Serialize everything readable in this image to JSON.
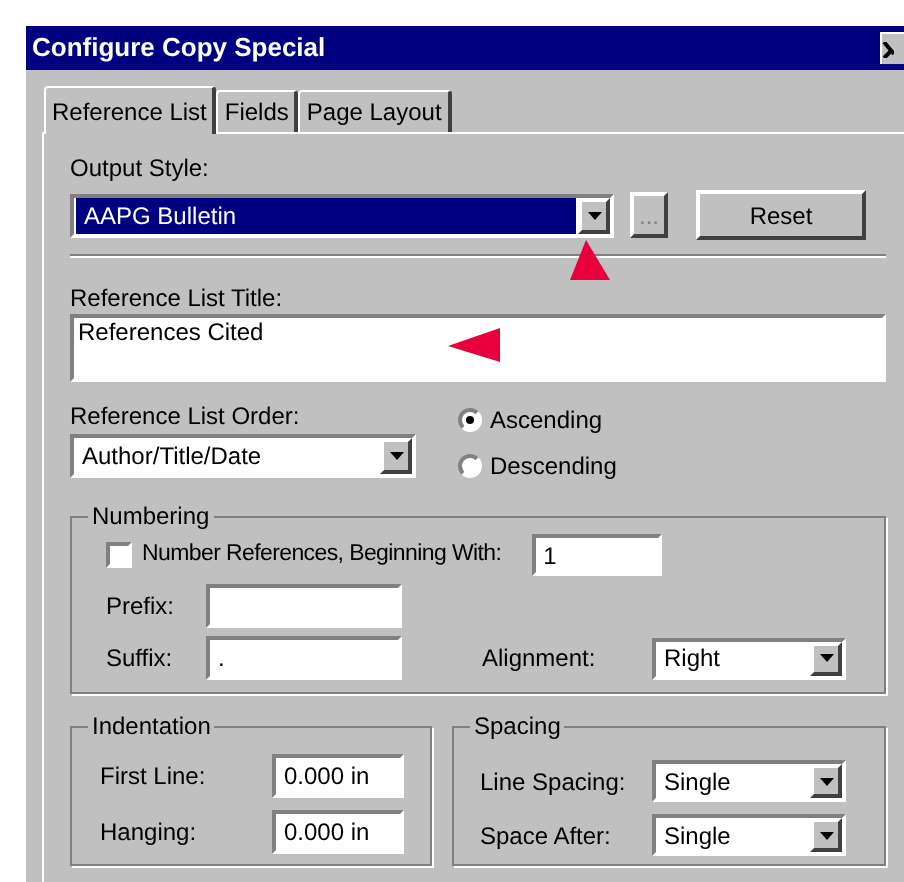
{
  "window": {
    "title": "Configure Copy Special"
  },
  "tabs": [
    {
      "label": "Reference List",
      "selected": true
    },
    {
      "label": "Fields",
      "selected": false
    },
    {
      "label": "Page Layout",
      "selected": false
    }
  ],
  "output_style": {
    "label": "Output Style:",
    "value": "AAPG Bulletin",
    "browse_button": "...",
    "reset_button": "Reset"
  },
  "reference_list_title": {
    "label": "Reference List Title:",
    "value": "References Cited"
  },
  "reference_list_order": {
    "label": "Reference List Order:",
    "value": "Author/Title/Date"
  },
  "sort_direction": [
    {
      "label": "Ascending",
      "selected": true
    },
    {
      "label": "Descending",
      "selected": false
    }
  ],
  "numbering": {
    "title": "Numbering",
    "number_references": {
      "label": "Number References, Beginning With:",
      "checked": false,
      "value": "1"
    },
    "prefix": {
      "label": "Prefix:"
    },
    "suffix": {
      "label": "Suffix:",
      "value": "."
    },
    "alignment": {
      "label": "Alignment:",
      "value": "Right"
    }
  },
  "indentation": {
    "title": "Indentation",
    "first_line": {
      "label": "First Line:",
      "value": "0.000 in"
    },
    "hanging": {
      "label": "Hanging:",
      "value": "0.000 in"
    }
  },
  "spacing": {
    "title": "Spacing",
    "line_spacing": {
      "label": "Line Spacing:",
      "value": "Single"
    },
    "space_after": {
      "label": "Space After:",
      "value": "Single"
    }
  }
}
